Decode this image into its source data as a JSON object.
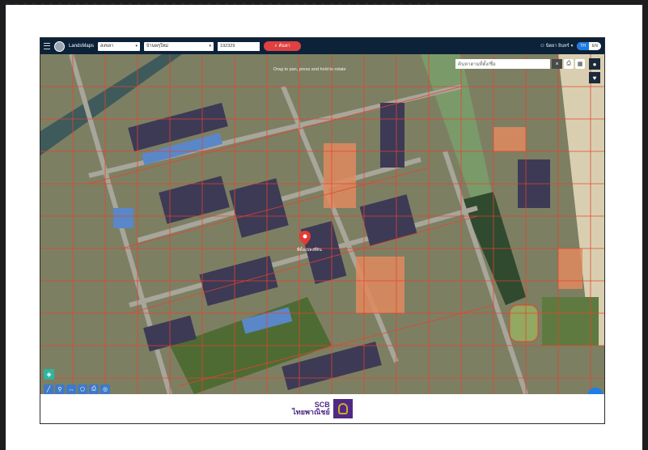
{
  "app": {
    "brand": "LandsMaps",
    "province_select": "สงขลา",
    "district_select": "บ้านพรุใหม่",
    "parcel_input": "192329",
    "search_button": "ค้นหา",
    "user_name": "นิตยา อินทร์",
    "lang_on": "TH",
    "lang_off": "EN"
  },
  "map": {
    "search_placeholder": "ค้นหาตามที่ตั้ง/ชื่อ",
    "hint_text": "Drag to pan, press and hold to rotate",
    "pin_label": "ที่ตั้งแปลงที่ดิน"
  },
  "footer": {
    "brand_line1": "SCB",
    "brand_line2": "ไทยพาณิชย์"
  },
  "colors": {
    "appbar": "#0c2238",
    "search_button": "#e04040",
    "parcel_lines": "#e8422c",
    "brand_purple": "#4e2a84"
  },
  "icons": {
    "menu": "hamburger-icon",
    "search": "search-icon",
    "user": "user-icon",
    "close": "close-icon",
    "layers": "layers-icon",
    "location": "location-icon",
    "favorite": "heart-icon",
    "pin": "map-pin-icon",
    "fab": "more-icon"
  }
}
